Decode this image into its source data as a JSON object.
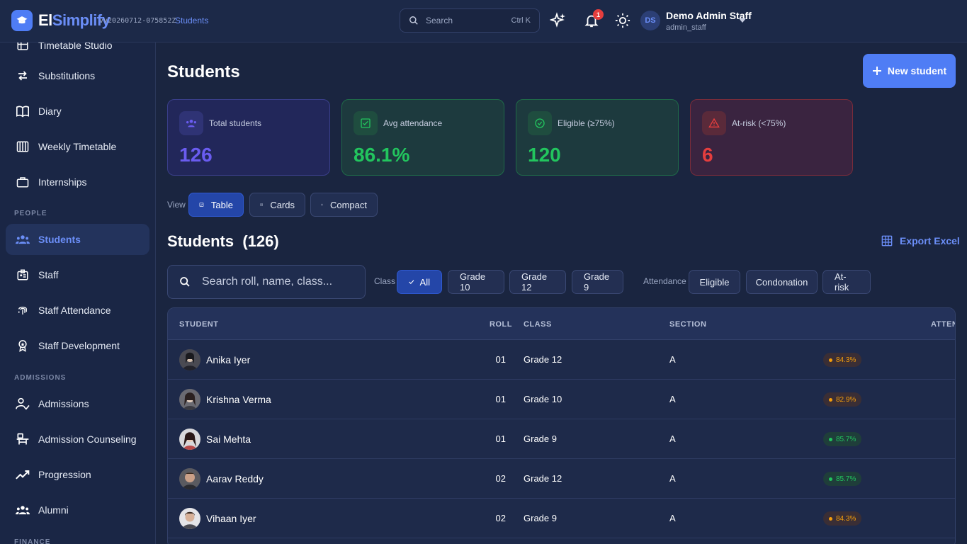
{
  "app": {
    "logo_a": "El",
    "logo_b": "Simplify",
    "version": "vv20260712-075852Z",
    "breadcrumb": "Students",
    "search_placeholder": "Search",
    "search_shortcut": "Ctrl K",
    "notifications_count": "1",
    "user_initials": "DS",
    "user_name": "Demo Admin Staff",
    "user_role": "admin_staff"
  },
  "sidebar": {
    "items": [
      {
        "label": "Timetable Studio",
        "icon": "grid-icon"
      },
      {
        "label": "Substitutions",
        "icon": "swap-icon"
      },
      {
        "label": "Diary",
        "icon": "book-icon"
      },
      {
        "label": "Weekly Timetable",
        "icon": "columns-icon"
      },
      {
        "label": "Internships",
        "icon": "briefcase-icon"
      },
      {
        "label": "Students",
        "icon": "people-icon"
      },
      {
        "label": "Staff",
        "icon": "badge-icon"
      },
      {
        "label": "Staff Attendance",
        "icon": "fingerprint-icon"
      },
      {
        "label": "Staff Development",
        "icon": "award-icon"
      },
      {
        "label": "Admissions",
        "icon": "user-check-icon"
      },
      {
        "label": "Admission Counseling",
        "icon": "counsel-icon"
      },
      {
        "label": "Progression",
        "icon": "trend-icon"
      },
      {
        "label": "Alumni",
        "icon": "group-icon"
      }
    ],
    "sections": {
      "people": "PEOPLE",
      "admissions": "ADMISSIONS",
      "finance": "FINANCE"
    }
  },
  "page": {
    "title": "Students",
    "new_button": "New student",
    "stats": [
      {
        "label": "Total students",
        "value": "126",
        "color": "#6a5cf0"
      },
      {
        "label": "Avg attendance",
        "value": "86.1%",
        "color": "#22c55e"
      },
      {
        "label": "Eligible (≥75%)",
        "value": "120",
        "color": "#22c55e"
      },
      {
        "label": "At-risk (<75%)",
        "value": "6",
        "color": "#e53e3e"
      }
    ],
    "view_label": "View",
    "views": [
      "Table",
      "Cards",
      "Compact"
    ],
    "section_title": "Students  (126)",
    "export_label": "Export Excel",
    "search_placeholder": "Search roll, name, class...",
    "class_label": "Class",
    "class_filters": [
      "All",
      "Grade 10",
      "Grade 12",
      "Grade 9"
    ],
    "attendance_label": "Attendance",
    "attendance_filters": [
      "Eligible",
      "Condonation",
      "At-risk"
    ]
  },
  "table": {
    "headers": [
      "STUDENT",
      "ROLL",
      "CLASS",
      "SECTION",
      "ATTEND"
    ],
    "rows": [
      {
        "name": "Anika Iyer",
        "roll": "01",
        "class": "Grade 12",
        "section": "A",
        "attendance": "84.3%",
        "status": "warn"
      },
      {
        "name": "Krishna Verma",
        "roll": "01",
        "class": "Grade 10",
        "section": "A",
        "attendance": "82.9%",
        "status": "warn"
      },
      {
        "name": "Sai Mehta",
        "roll": "01",
        "class": "Grade 9",
        "section": "A",
        "attendance": "85.7%",
        "status": "good"
      },
      {
        "name": "Aarav Reddy",
        "roll": "02",
        "class": "Grade 12",
        "section": "A",
        "attendance": "85.7%",
        "status": "good"
      },
      {
        "name": "Vihaan Iyer",
        "roll": "02",
        "class": "Grade 9",
        "section": "A",
        "attendance": "84.3%",
        "status": "warn"
      }
    ]
  },
  "colors": {
    "accent": "#4f7df5",
    "warn": "#f59e0b",
    "good": "#22c55e",
    "danger": "#e53e3e"
  }
}
